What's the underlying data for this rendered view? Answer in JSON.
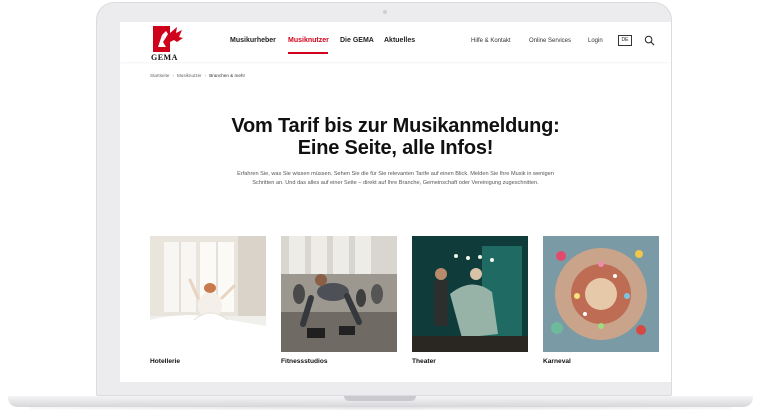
{
  "header": {
    "logo_text": "GEMA",
    "nav": [
      "Musikurheber",
      "Musiknutzer",
      "Die GEMA",
      "Aktuelles"
    ],
    "active_nav": "Musiknutzer",
    "utility": [
      "Hilfe & Kontakt",
      "Online Services",
      "Login"
    ],
    "language": "DE",
    "accent_color": "#d0021b"
  },
  "breadcrumb": [
    "Startseite",
    "Musiknutzer",
    "Branchen & mehr"
  ],
  "hero": {
    "headline_line1": "Vom Tarif bis zur Musikanmeldung:",
    "headline_line2": "Eine Seite, alle Infos!",
    "intro": "Erfahren Sie, was Sie wissen müssen. Sehen Sie die für Sie relevanten Tarife auf einen Blick. Melden Sie Ihre Musik in wenigen Schritten an. Und das alles auf einer Seite – direkt auf Ihre Branche, Gemeinschaft oder Vereinigung zugeschnitten."
  },
  "cards": [
    {
      "label": "Hotellerie"
    },
    {
      "label": "Fitnessstudios"
    },
    {
      "label": "Theater"
    },
    {
      "label": "Karneval"
    }
  ],
  "icons": [
    "gema-logo-icon",
    "search-icon"
  ]
}
